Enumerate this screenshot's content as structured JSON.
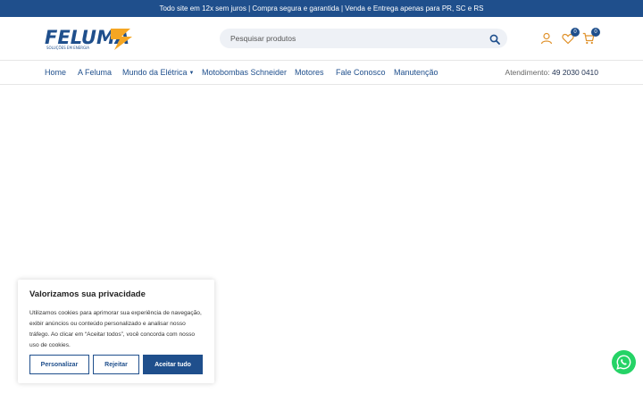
{
  "topbar": {
    "text": "Todo site em 12x sem juros | Compra segura e garantida | Venda e Entrega apenas para PR, SC e RS"
  },
  "logo": {
    "name": "FELUMA",
    "tagline": "SOLUÇÕES EM ENERGIA"
  },
  "search": {
    "placeholder": "Pesquisar produtos"
  },
  "header": {
    "wishlist_count": "0",
    "cart_count": "0"
  },
  "nav": {
    "items": [
      "Home",
      "A Feluma",
      "Mundo da Elétrica",
      "Motobombas Schneider",
      "Motores",
      "Fale Conosco",
      "Manutenção"
    ],
    "attend_label": "Atendimento:",
    "attend_phone": "49 2030 0410"
  },
  "cookie": {
    "title": "Valorizamos sua privacidade",
    "text": "Utilizamos cookies para aprimorar sua experiência de navegação, exibir anúncios ou conteúdo personalizado e analisar nosso tráfego. Ao clicar em “Aceitar todos”, você concorda com nosso uso de cookies.",
    "customize": "Personalizar",
    "reject": "Rejeitar",
    "accept": "Aceitar tudo"
  },
  "colors": {
    "brand": "#1f4f8c",
    "accent": "#f5a623",
    "whatsapp": "#25d366"
  },
  "icons": [
    "search-icon",
    "user-icon",
    "heart-icon",
    "cart-icon",
    "whatsapp-icon"
  ]
}
